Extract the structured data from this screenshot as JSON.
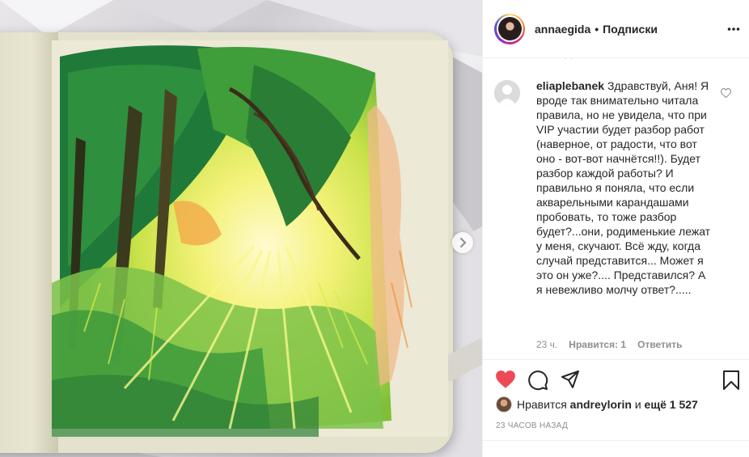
{
  "post": {
    "image_alt": "Colored pencil drawing of a sunlit forest in a sketchbook"
  },
  "header": {
    "username": "annaegida",
    "separator": "•",
    "follow_label": "Подписки",
    "more_icon": "more-horizontal-icon"
  },
  "comment": {
    "username": "eliaplebanek",
    "text": "Здравствуй, Аня! Я вроде так внимательно читала правила, но не увидела, что при VIP участии будет разбор работ (наверное, от радости, что вот оно - вот-вот начнётся!!). Будет разбор каждой работы? И правильно я поняла, что если акварельными карандашами пробовать, то тоже разбор будет?...они, родименькие лежат у меня, скучают. Всё жду, когда случай представится... Может я это он уже?.... Представился? А я невежливо молчу ответ?.....",
    "age": "23 ч.",
    "likes": "Нравится: 1",
    "reply": "Ответить"
  },
  "likes_line": {
    "prefix": "Нравится",
    "user": "andreylorin",
    "and": "и",
    "more": "ещё 1 527"
  },
  "timestamp": "23 часов назад",
  "colors": {
    "heart_red": "#ed4956",
    "text": "#262626",
    "muted": "#8e8e8e",
    "border": "#efefef"
  }
}
